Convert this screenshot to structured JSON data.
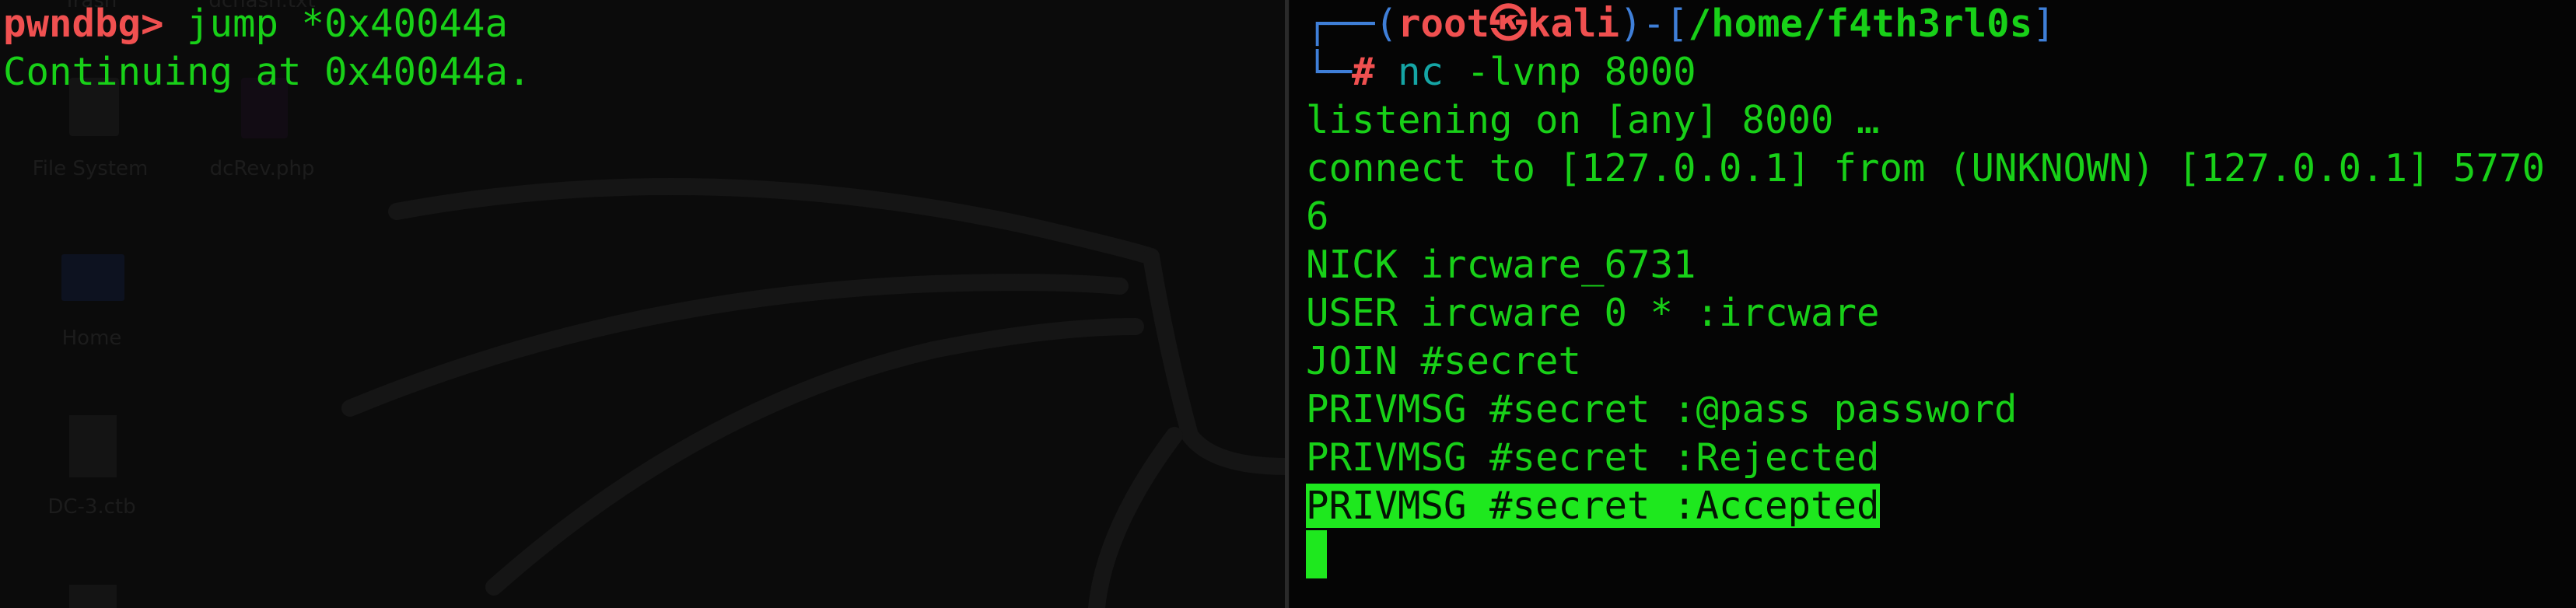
{
  "desktop": {
    "icons": [
      {
        "label": "Trash"
      },
      {
        "label": "dchash.txt"
      },
      {
        "label": "File System"
      },
      {
        "label": "dcRev.php"
      },
      {
        "label": "Home"
      },
      {
        "label": "DC-3.ctb"
      }
    ]
  },
  "left_terminal": {
    "prompt": "pwndbg>",
    "command": " jump *0x40044a",
    "output": "Continuing at 0x40044a."
  },
  "right_terminal": {
    "frame_top": "┌──(",
    "user": "root",
    "at_symbol": "㉿",
    "host": "kali",
    "sep": ")-[",
    "cwd": "/home/f4th3rl0s",
    "close": "]",
    "frame_bottom": "└─",
    "prompt_char": "#",
    "cmd": "nc",
    "args": " -lvnp 8000",
    "lines": [
      "listening on [any] 8000 …",
      "connect to [127.0.0.1] from (UNKNOWN) [127.0.0.1] 5770",
      "6",
      "NICK ircware_6731",
      "USER ircware 0 * :ircware",
      "JOIN #secret",
      "PRIVMSG #secret :@pass password",
      "PRIVMSG #secret :Rejected"
    ],
    "highlighted_line": "PRIVMSG #secret :Accepted"
  },
  "colors": {
    "red": "#f05050",
    "green": "#18d018",
    "blue": "#3f7fd8",
    "teal": "#15a5a5",
    "highlight": "#1ee81e"
  }
}
